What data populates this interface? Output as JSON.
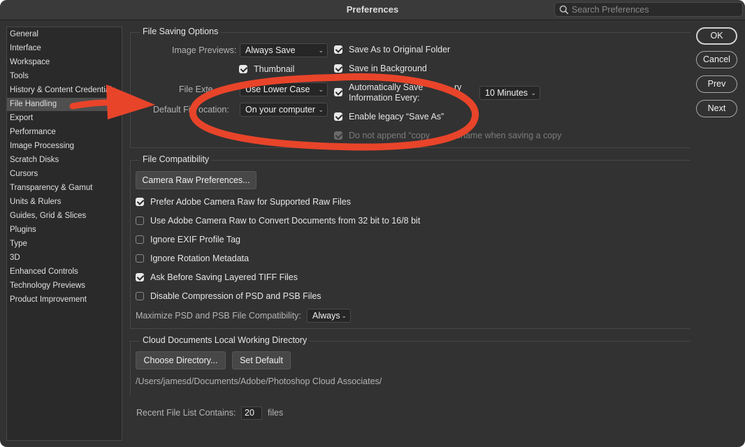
{
  "window": {
    "title": "Preferences"
  },
  "search": {
    "placeholder": "Search Preferences"
  },
  "sidebar": {
    "items": [
      {
        "label": "General"
      },
      {
        "label": "Interface"
      },
      {
        "label": "Workspace"
      },
      {
        "label": "Tools"
      },
      {
        "label": "History & Content Credentials"
      },
      {
        "label": "File Handling"
      },
      {
        "label": "Export"
      },
      {
        "label": "Performance"
      },
      {
        "label": "Image Processing"
      },
      {
        "label": "Scratch Disks"
      },
      {
        "label": "Cursors"
      },
      {
        "label": "Transparency & Gamut"
      },
      {
        "label": "Units & Rulers"
      },
      {
        "label": "Guides, Grid & Slices"
      },
      {
        "label": "Plugins"
      },
      {
        "label": "Type"
      },
      {
        "label": "3D"
      },
      {
        "label": "Enhanced Controls"
      },
      {
        "label": "Technology Previews"
      },
      {
        "label": "Product Improvement"
      }
    ],
    "selected": "File Handling"
  },
  "file_saving": {
    "heading": "File Saving Options",
    "image_previews_label": "Image Previews:",
    "image_previews_value": "Always Save",
    "thumbnail_label": "Thumbnail",
    "thumbnail_checked": true,
    "file_extension_label": "File Exte",
    "file_extension_value": "Use Lower Case",
    "default_location_label": "Default Fi",
    "default_location_label_tail": "ocation:",
    "default_location_value": "On your computer",
    "save_as_original_label": "Save As to Original Folder",
    "save_as_original_checked": true,
    "save_in_background_label": "Save in Background",
    "save_in_background_checked": true,
    "auto_save_label_1": "Automatically Save",
    "auto_save_label_1_tail": "ry",
    "auto_save_label_2": "Information Every:",
    "auto_save_checked": true,
    "auto_save_interval": "10 Minutes",
    "legacy_save_as_label": "Enable legacy “Save As”",
    "legacy_save_as_checked": true,
    "no_copy_label": "Do not append “copy",
    "no_copy_label_tail": "ename when saving a copy",
    "no_copy_checked": true
  },
  "compat": {
    "heading": "File Compatibility",
    "camera_raw_button": "Camera Raw Preferences...",
    "options": [
      {
        "label": "Prefer Adobe Camera Raw for Supported Raw Files",
        "checked": true
      },
      {
        "label": "Use Adobe Camera Raw to Convert Documents from 32 bit to 16/8 bit",
        "checked": false
      },
      {
        "label": "Ignore EXIF Profile Tag",
        "checked": false
      },
      {
        "label": "Ignore Rotation Metadata",
        "checked": false
      },
      {
        "label": "Ask Before Saving Layered TIFF Files",
        "checked": true
      },
      {
        "label": "Disable Compression of PSD and PSB Files",
        "checked": false
      }
    ],
    "maximize_label": "Maximize PSD and PSB File Compatibility:",
    "maximize_value": "Always"
  },
  "cloud": {
    "heading": "Cloud Documents Local Working Directory",
    "choose_button": "Choose Directory...",
    "default_button": "Set Default",
    "path": "/Users/jamesd/Documents/Adobe/Photoshop Cloud Associates/"
  },
  "recent": {
    "label": "Recent File List Contains:",
    "value": "20",
    "suffix": "files"
  },
  "buttons": {
    "ok": "OK",
    "cancel": "Cancel",
    "prev": "Prev",
    "next": "Next"
  },
  "annotation": {
    "color": "#e8442a"
  }
}
